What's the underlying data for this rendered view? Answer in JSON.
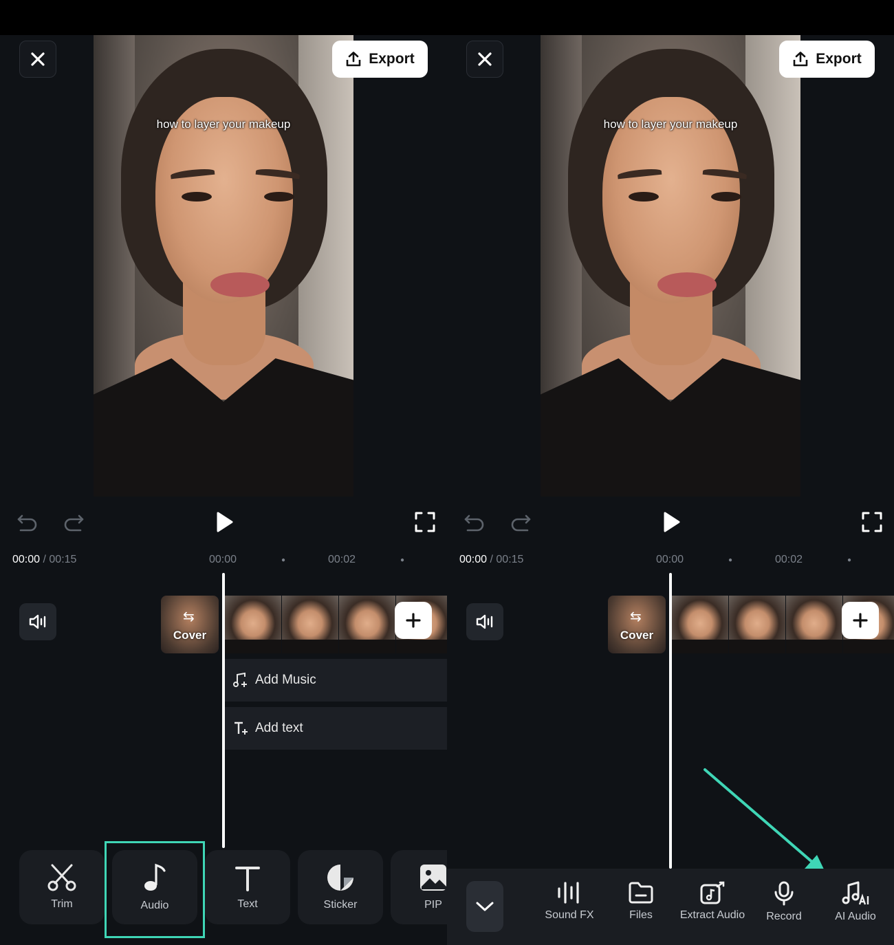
{
  "screens": [
    {
      "id": "left",
      "close_icon": "close-icon",
      "export_label": "Export",
      "caption": "how to layer your makeup",
      "time_current": "00:00",
      "time_separator": "/",
      "time_total": "00:15",
      "ticks": [
        "00:00",
        "00:02"
      ],
      "cover_label": "Cover",
      "tracks": [
        {
          "icon": "music-add-icon",
          "label": "Add Music"
        },
        {
          "icon": "text-add-icon",
          "label": "Add text"
        }
      ],
      "tools": [
        {
          "icon": "scissors-icon",
          "label": "Trim"
        },
        {
          "icon": "music-note-icon",
          "label": "Audio",
          "highlighted": true
        },
        {
          "icon": "text-icon",
          "label": "Text"
        },
        {
          "icon": "sticker-icon",
          "label": "Sticker"
        },
        {
          "icon": "image-icon",
          "label": "PIP"
        }
      ]
    },
    {
      "id": "right",
      "close_icon": "close-icon",
      "export_label": "Export",
      "caption": "how to layer your makeup",
      "time_current": "00:00",
      "time_separator": "/",
      "time_total": "00:15",
      "ticks": [
        "00:00",
        "00:02"
      ],
      "cover_label": "Cover",
      "audio_tools": [
        {
          "icon": "waveform-icon",
          "label": "Sound FX"
        },
        {
          "icon": "folder-icon",
          "label": "Files"
        },
        {
          "icon": "extract-audio-icon",
          "label": "Extract Audio"
        },
        {
          "icon": "microphone-icon",
          "label": "Record"
        },
        {
          "icon": "ai-music-icon",
          "label": "AI Audio"
        }
      ]
    }
  ],
  "colors": {
    "background": "#0f1216",
    "highlight": "#3fd6b6",
    "export_bg": "#ffffff",
    "tool_bg": "#1a1d22"
  }
}
